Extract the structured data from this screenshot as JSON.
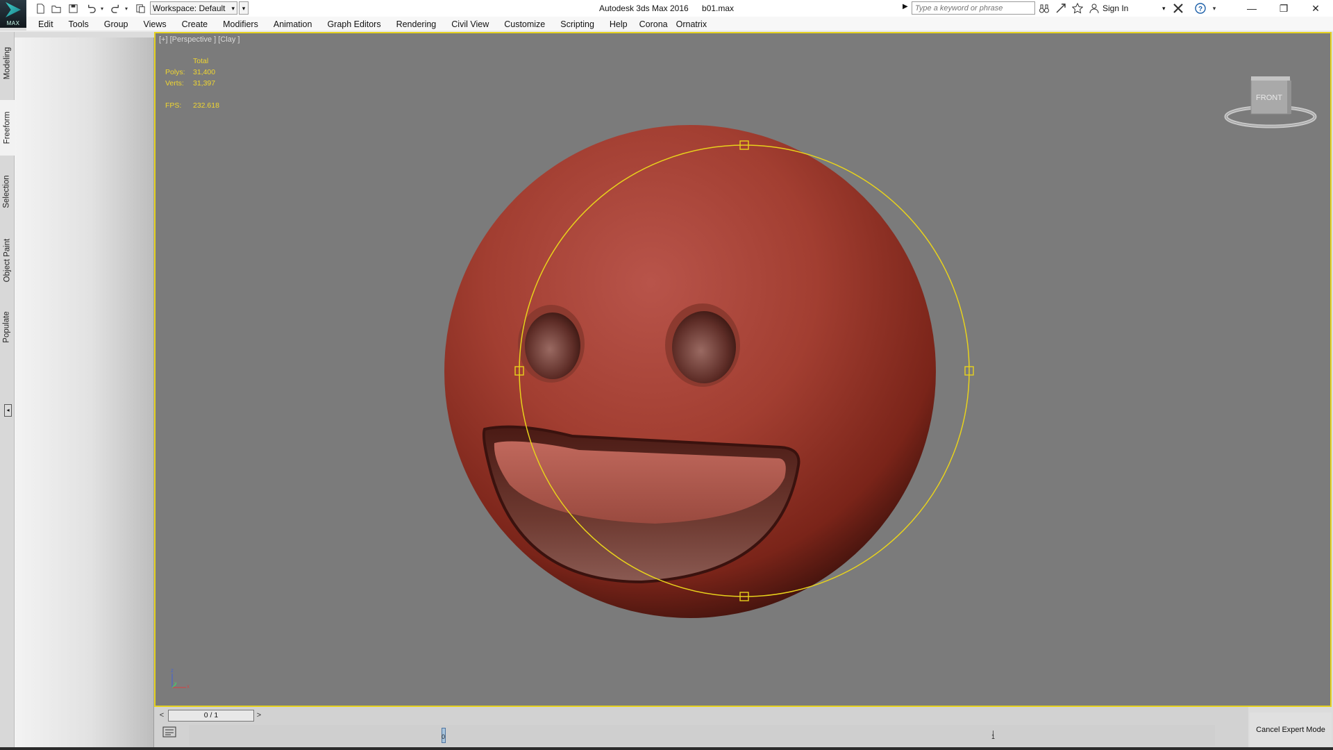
{
  "app": {
    "logo_text": "MAX",
    "title": "Autodesk 3ds Max 2016",
    "filename": "b01.max"
  },
  "workspace": {
    "label": "Workspace: Default"
  },
  "search": {
    "placeholder": "Type a keyword or phrase"
  },
  "account": {
    "signin_label": "Sign In"
  },
  "menu": [
    "Edit",
    "Tools",
    "Group",
    "Views",
    "Create",
    "Modifiers",
    "Animation",
    "Graph Editors",
    "Rendering",
    "Civil View",
    "Customize",
    "Scripting",
    "Help",
    "Corona",
    "Ornatrix"
  ],
  "ribbon_tabs": [
    "Modeling",
    "Freeform",
    "Selection",
    "Object Paint",
    "Populate"
  ],
  "viewport": {
    "label": "[+] [Perspective ] [Clay ]",
    "stats": {
      "header": "Total",
      "polys_label": "Polys:",
      "polys_value": "31,400",
      "verts_label": "Verts:",
      "verts_value": "31,397",
      "fps_label": "FPS:",
      "fps_value": "232.618"
    },
    "viewcube_label": "FRONT",
    "axes": {
      "z": "z",
      "y": "y",
      "x": "x"
    }
  },
  "timeline": {
    "frame_display": "0 / 1",
    "prev_label": "<",
    "next_label": ">",
    "track_start": "0",
    "track_end": "1"
  },
  "status": {
    "cancel_expert_label": "Cancel Expert Mode"
  },
  "colors": {
    "viewport_bg": "#7b7b7b",
    "active_border": "#e6d21f",
    "stats_text": "#f0d630",
    "model_red": "#a33b2e"
  },
  "icons": [
    "app-logo-icon",
    "new-file-icon",
    "open-file-icon",
    "save-icon",
    "undo-icon",
    "redo-icon",
    "project-icon",
    "binoculars-icon",
    "exchange-icon",
    "star-icon",
    "user-icon",
    "autodesk-x-icon",
    "help-icon",
    "minimize-icon",
    "restore-icon",
    "close-icon"
  ]
}
